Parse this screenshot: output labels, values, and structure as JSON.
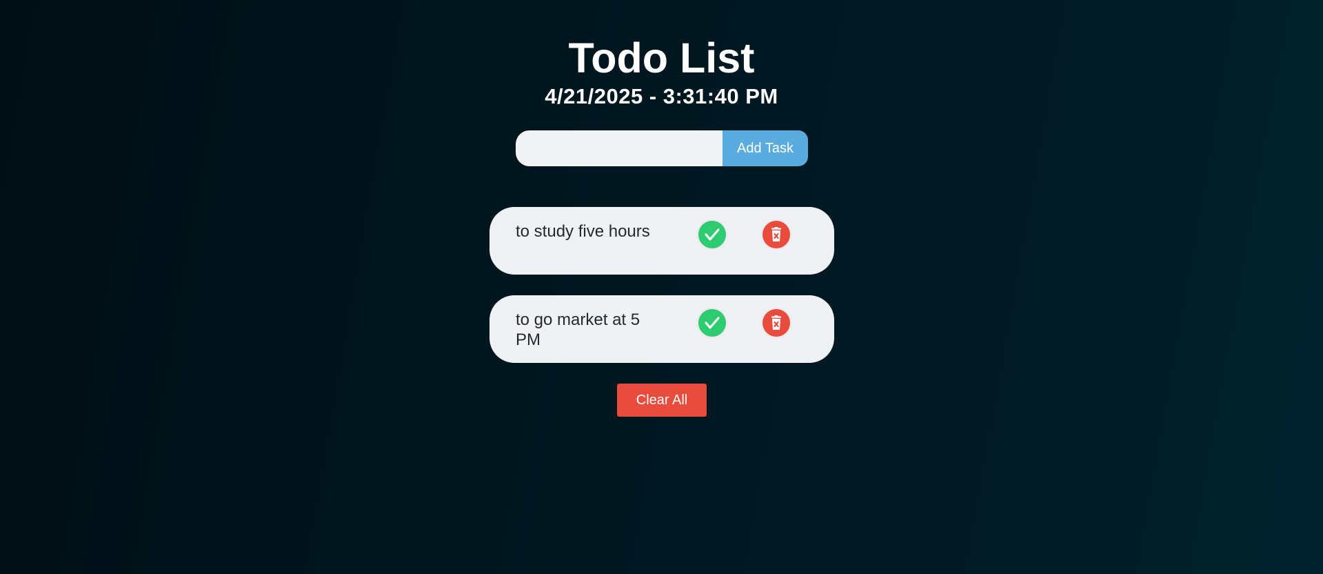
{
  "header": {
    "title": "Todo List",
    "datetime": "4/21/2025 - 3:31:40 PM"
  },
  "add_form": {
    "input_value": "",
    "input_placeholder": "",
    "add_button_label": "Add Task"
  },
  "tasks": [
    {
      "text": "to study five hours",
      "complete_icon": "check-circle-icon",
      "delete_icon": "trash-x-icon"
    },
    {
      "text": "to go market at 5 PM",
      "complete_icon": "check-circle-icon",
      "delete_icon": "trash-x-icon"
    }
  ],
  "footer": {
    "clear_button_label": "Clear All"
  },
  "colors": {
    "background": "#001820",
    "accent_blue": "#5aacdf",
    "success_green": "#2ecc71",
    "danger_red": "#e74c3c",
    "card_bg": "#f0f1f3"
  }
}
